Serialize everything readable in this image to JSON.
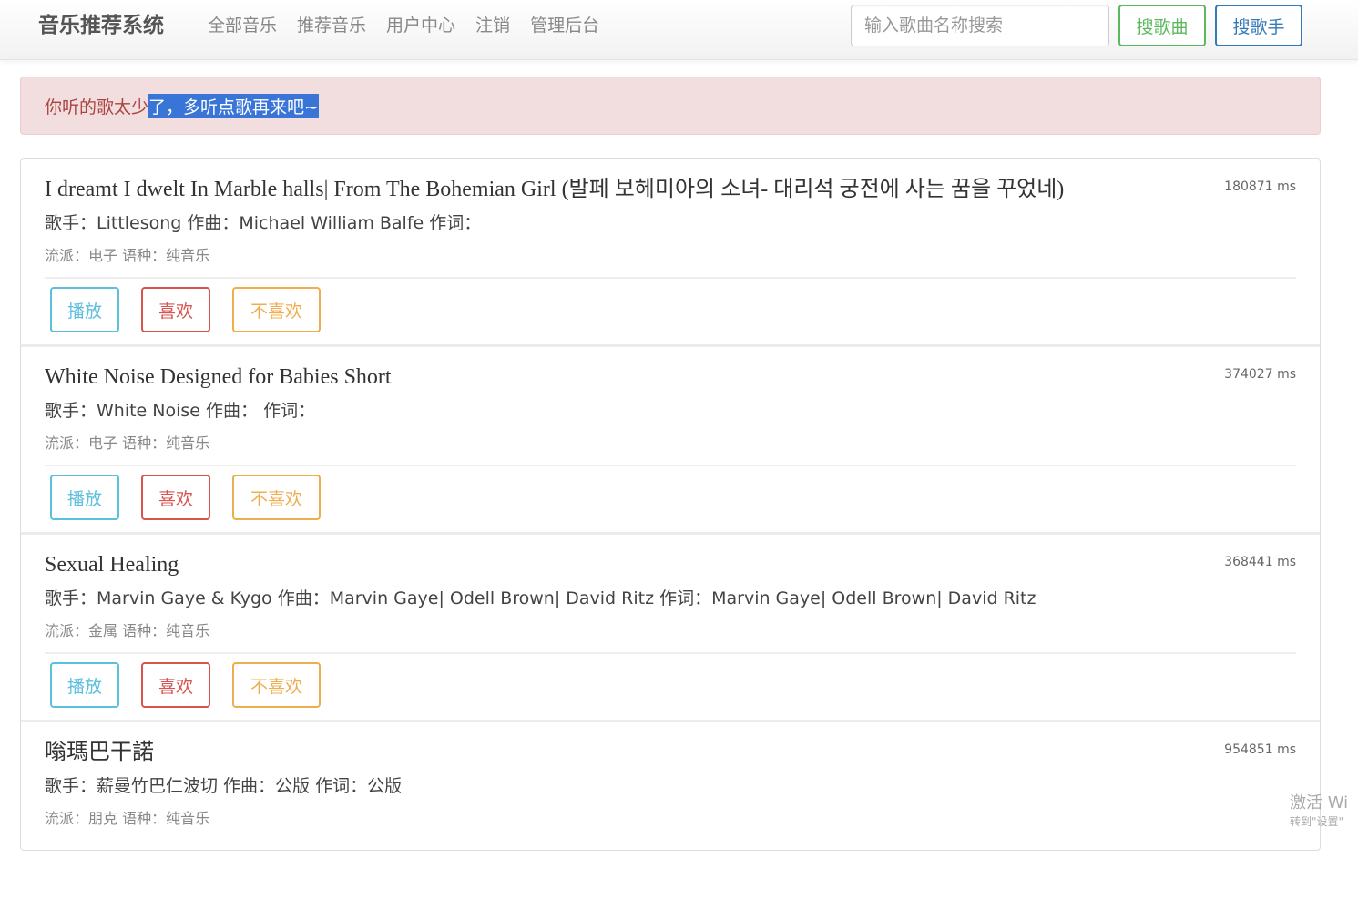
{
  "navbar": {
    "brand": "音乐推荐系统",
    "links": [
      "全部音乐",
      "推荐音乐",
      "用户中心",
      "注销",
      "管理后台"
    ],
    "search_placeholder": "输入歌曲名称搜索",
    "search_song_label": "搜歌曲",
    "search_singer_label": "搜歌手"
  },
  "alert": {
    "text_plain": "你听的歌太少",
    "text_selected": "了，多听点歌再来吧~"
  },
  "songs": [
    {
      "title": "I dreamt I dwelt In Marble halls| From The Bohemian Girl (발페 보헤미아의 소녀- 대리석 궁전에 사는 꿈을 꾸었네)",
      "duration": "180871 ms",
      "meta": "歌手：Littlesong 作曲：Michael William Balfe 作词：",
      "tags": "流派：电子 语种：纯音乐"
    },
    {
      "title": "White Noise Designed for Babies Short",
      "duration": "374027 ms",
      "meta": "歌手：White Noise 作曲： 作词：",
      "tags": "流派：电子 语种：纯音乐"
    },
    {
      "title": "Sexual Healing",
      "duration": "368441 ms",
      "meta": "歌手：Marvin Gaye & Kygo 作曲：Marvin Gaye| Odell Brown| David Ritz 作词：Marvin Gaye| Odell Brown| David Ritz",
      "tags": "流派：金属 语种：纯音乐"
    },
    {
      "title": "嗡瑪巴干諾",
      "duration": "954851 ms",
      "meta": "歌手：薪曼竹巴仁波切 作曲：公版 作词：公版",
      "tags": "流派：朋克 语种：纯音乐"
    }
  ],
  "actions": {
    "play_label": "播放",
    "like_label": "喜欢",
    "dislike_label": "不喜欢"
  },
  "watermark": {
    "line1": "激活 Wi",
    "line2": "转到\"设置\""
  }
}
